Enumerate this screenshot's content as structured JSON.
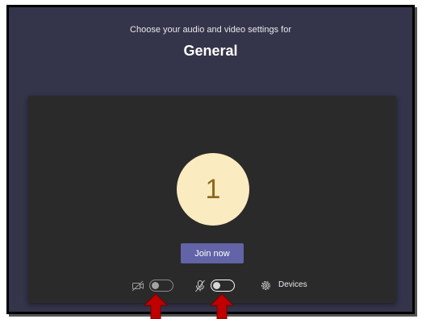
{
  "prompt": "Choose your audio and video settings for",
  "channel_name": "General",
  "avatar_initial": "1",
  "join_button_label": "Join now",
  "devices_label": "Devices",
  "icons": [
    "camera-off-icon",
    "mic-off-icon",
    "gear-icon",
    "red-arrow-up-icon"
  ],
  "colors": {
    "background": "#34344a",
    "preview": "#2b2a2a",
    "avatar": "#fbebc0",
    "join_button": "#6264a7",
    "annotation_arrow": "#c00000"
  },
  "toggles": {
    "camera_on": false,
    "microphone_on": false
  }
}
